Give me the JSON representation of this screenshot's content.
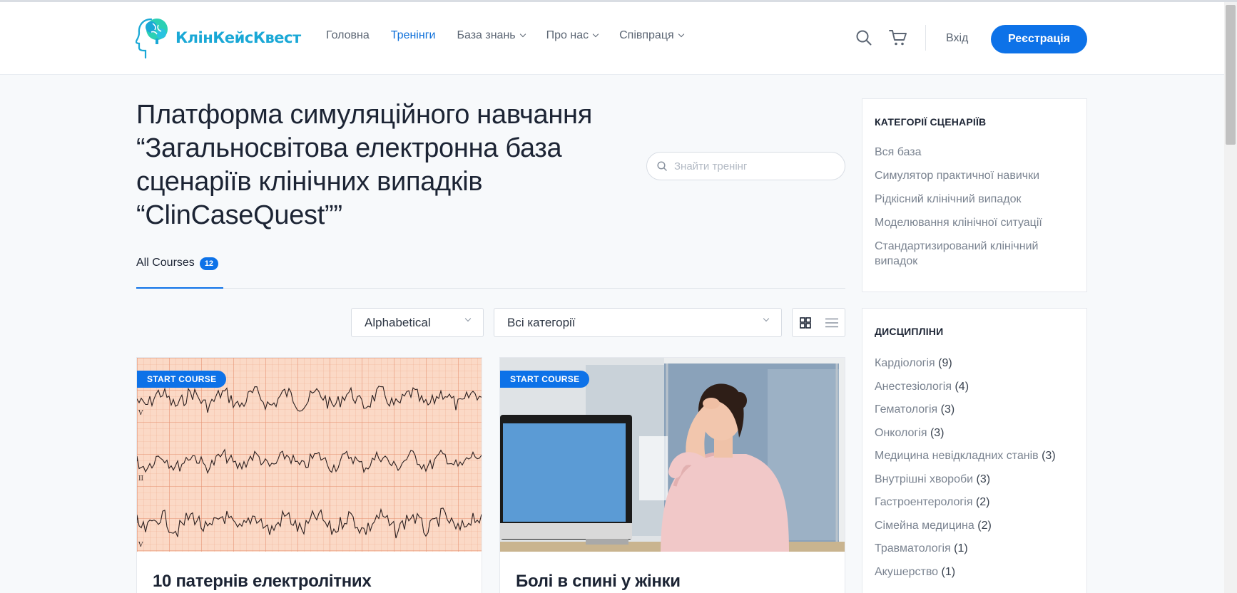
{
  "brand": {
    "name": "КлінКейсКвест",
    "color": "#1aa8d6"
  },
  "nav": {
    "items": [
      {
        "label": "Головна",
        "active": false,
        "dropdown": false
      },
      {
        "label": "Тренінги",
        "active": true,
        "dropdown": false
      },
      {
        "label": "База знань",
        "active": false,
        "dropdown": true
      },
      {
        "label": "Про нас",
        "active": false,
        "dropdown": true
      },
      {
        "label": "Співпраця",
        "active": false,
        "dropdown": true
      }
    ],
    "login_label": "Вхід",
    "register_label": "Реєстрація",
    "icons": [
      "search-icon",
      "cart-icon"
    ]
  },
  "main": {
    "title": "Платформа симуляційного навчання “Загальносвітова електронна база сценаріїв клінічних випадків “ClinCaseQuest””",
    "search_placeholder": "Знайти тренінг",
    "tab": {
      "label": "All Courses",
      "count": "12"
    },
    "sort_value": "Alphabetical",
    "category_value": "Всі категорії",
    "view_modes": [
      "grid-view-icon",
      "list-view-icon"
    ],
    "accent": "#0d72e8"
  },
  "courses": [
    {
      "badge": "START COURSE",
      "title": "10 патернів електролітних",
      "image": "ecg-strip"
    },
    {
      "badge": "START COURSE",
      "title": "Болі в спині у жінки",
      "image": "woman-headache-office"
    }
  ],
  "sidebar": {
    "categories_title": "КАТЕГОРІЇ СЦЕНАРІЇВ",
    "categories": [
      "Вся база",
      "Симулятор практичної навички",
      "Рідкісний клінічний випадок",
      "Моделювання клінічної ситуації",
      "Стандартизирований клінічний випадок"
    ],
    "disciplines_title": "ДИСЦИПЛІНИ",
    "disciplines": [
      {
        "name": "Кардіологія",
        "count": "(9)"
      },
      {
        "name": "Анестезіологія",
        "count": "(4)"
      },
      {
        "name": "Гематологія",
        "count": "(3)"
      },
      {
        "name": "Онкологія",
        "count": "(3)"
      },
      {
        "name": "Медицина невідкладних станів",
        "count": "(3)"
      },
      {
        "name": "Внутрішні хвороби",
        "count": "(3)"
      },
      {
        "name": "Гастроентерологія",
        "count": "(2)"
      },
      {
        "name": "Сімейна медицина",
        "count": "(2)"
      },
      {
        "name": "Травматологія",
        "count": "(1)"
      },
      {
        "name": "Акушерство",
        "count": "(1)"
      }
    ]
  }
}
